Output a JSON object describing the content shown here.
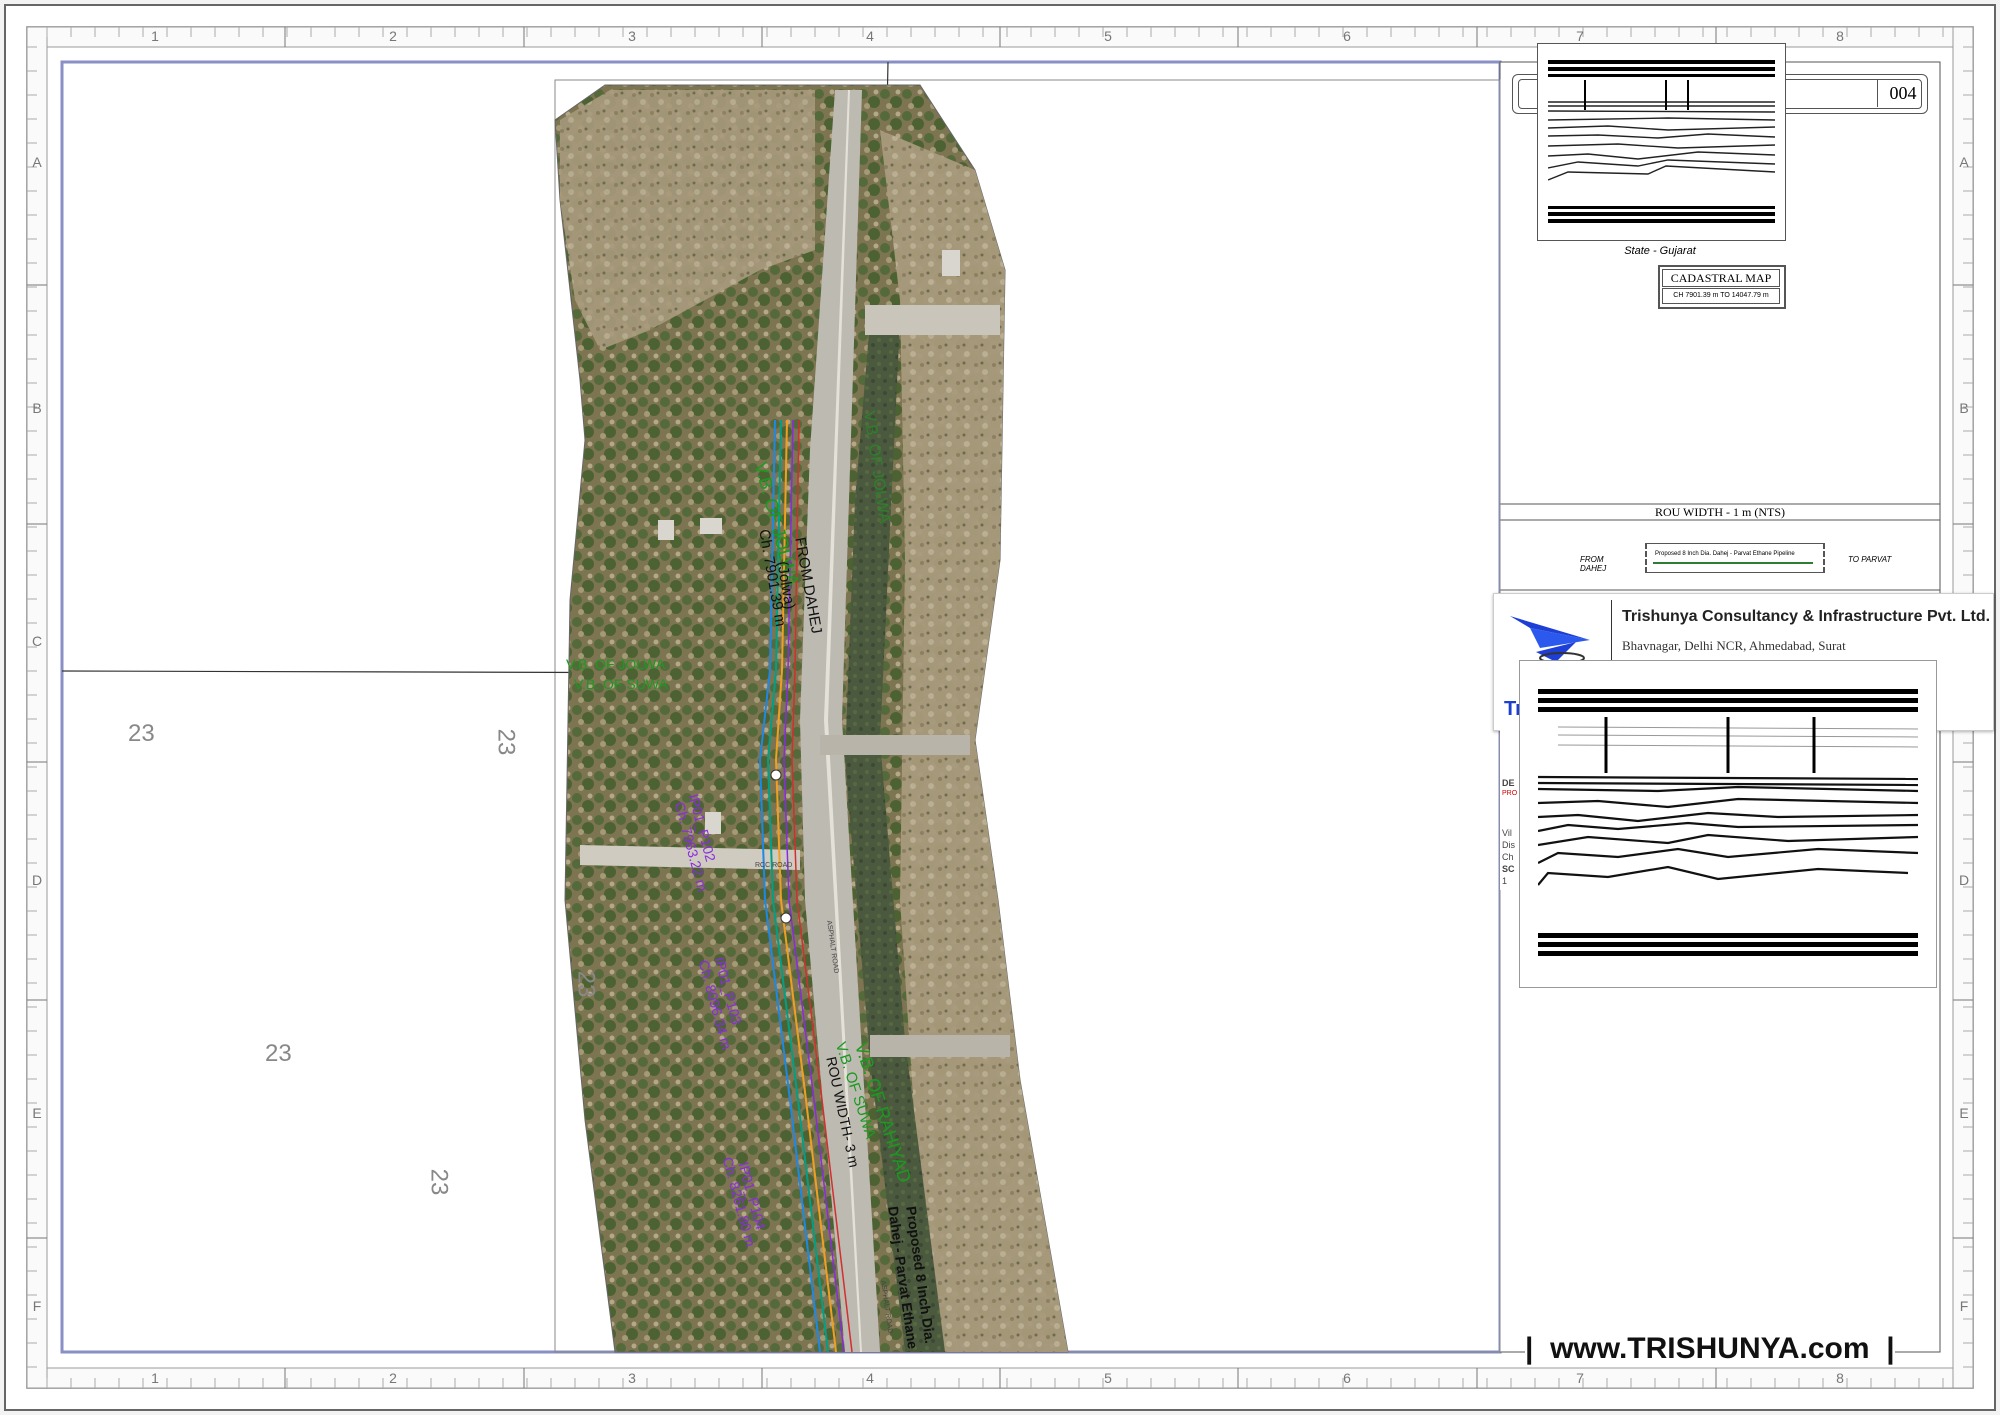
{
  "grid": {
    "columns": [
      "1",
      "2",
      "3",
      "4",
      "5",
      "6",
      "7",
      "8"
    ],
    "rows": [
      "A",
      "B",
      "C",
      "D",
      "E",
      "F"
    ]
  },
  "parcels": [
    "23",
    "23",
    "23",
    "23",
    "23"
  ],
  "map_labels": {
    "vb_jolwa_upper": "V.B. OF JOLWA",
    "vb_jolwa_upper_dup": "V.B. OF JOLWA",
    "vb_jolwa_lower": "V.B. OF JOLWA",
    "vb_suwa_upper": "V.B. OF SUWA",
    "vb_rahiyad": "V.B. OF RAHIYAD",
    "vb_suwa_lower": "V.B. OF SUWA",
    "from_dahej": "FROM DAHEJ",
    "jolwa": "(Jolwa)",
    "chainage_start": "Ch. 7901.39 m",
    "ip1_name": "IP01_P102",
    "ip1_ch": "Ch. 7963.22 m",
    "ip2_name": "IP01_P103",
    "ip2_ch": "Ch. 8096.34 m",
    "ip3_name": "IP01_P104",
    "ip3_ch": "Ch. 8261.80 m",
    "rou_width": "ROU WIDTH- 3 m",
    "pipeline_line1": "Proposed 8 Inch Dia.",
    "pipeline_line2": "Dahej - Parvat Ethane",
    "asphalt_road1": "ASPHALT ROAD",
    "asphalt_road2": "ASPHALT ROAD",
    "rcc_road": "RCC ROAD"
  },
  "title_block": {
    "sheet_no": "004",
    "state": "State - Gujarat",
    "map_title": "CADASTRAL MAP",
    "chainage_range": "CH 7901.39 m  TO  14047.79 m",
    "rou_width_header": "ROU WIDTH - 1 m (NTS)",
    "from_label": "FROM\nDAHEJ",
    "to_label": "TO PARVAT",
    "pipeline_legend": "Proposed 8 Inch Dia. Dahej - Parvat Ethane Pipeline",
    "company_name": "Trishunya Consultancy & Infrastructure Pvt. Ltd.",
    "company_locations": "Bhavnagar, Delhi NCR, Ahmedabad, Surat",
    "logo_text": "Tr",
    "side_rows": [
      "DE",
      "PRO",
      "",
      "Vil",
      "Dis",
      "Ch",
      "SC",
      "1"
    ]
  },
  "website": "|  www.TRISHUNYA.com  |",
  "colors": {
    "frame": "#8a8fc4",
    "green_label": "#1a9a20",
    "purple_label": "#8a2be2",
    "logo_blue": "#1d3fd6"
  }
}
